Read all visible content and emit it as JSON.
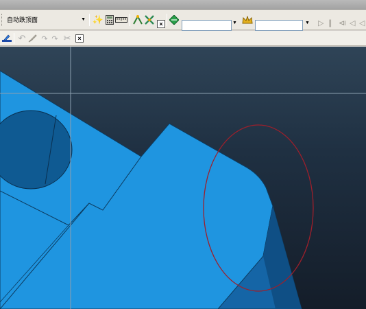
{
  "toolbar": {
    "mode_select": {
      "value": "自动跌顶面"
    },
    "combo_a": {
      "value": ""
    },
    "combo_b": {
      "value": ""
    }
  },
  "colors": {
    "part_face": "#1f95e0",
    "part_shadow": "#0f5a92",
    "annotation_ellipse": "#9e1f2b",
    "crosshair": "#8ca0b0"
  },
  "icons": [
    "sketch-icon",
    "undo-icon",
    "brush-icon",
    "redo-icon",
    "redo2-icon",
    "scissors-icon",
    "wand-icon",
    "calculator-icon",
    "ruler-icon",
    "measure-icon",
    "cross-tool-icon",
    "green-diamond-icon",
    "crown-icon",
    "play-icon",
    "pause-icon",
    "step-back-icon",
    "step-forward-icon"
  ]
}
